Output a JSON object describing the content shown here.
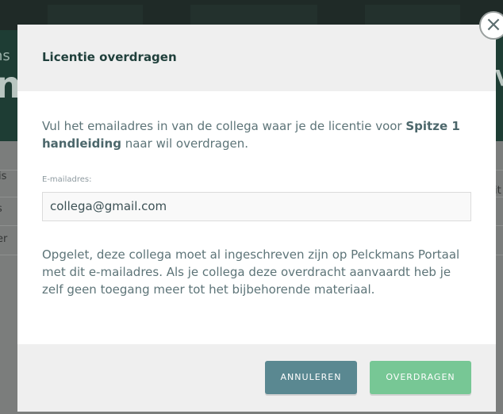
{
  "background": {
    "title_fragment": "ns",
    "big_fragment": "n",
    "right_fragment": "V",
    "row_texts": [
      "is",
      "s",
      "er"
    ],
    "right_text": "it"
  },
  "modal": {
    "title": "Licentie overdragen",
    "close_symbol": "×",
    "intro": {
      "before": "Vul het emailadres in van de collega waar je de licentie voor ",
      "product": "Spitze 1 handleiding",
      "after": " naar wil overdragen."
    },
    "email_label": "E-mailadres:",
    "email_value": "collega@gmail.com",
    "warning": "Opgelet, deze collega moet al ingeschreven zijn op Pelckmans Portaal met dit e-mailadres. Als je collega deze overdracht aanvaardt heb je zelf geen toegang meer tot het bijbehorende materiaal.",
    "buttons": {
      "cancel": "ANNULEREN",
      "confirm": "OVERDRAGEN"
    }
  },
  "colors": {
    "header_bg": "#1e3d34",
    "title": "#1f3f3b",
    "body_text": "#5d7478",
    "cancel_btn": "#5a8891",
    "confirm_btn": "#77c795"
  }
}
